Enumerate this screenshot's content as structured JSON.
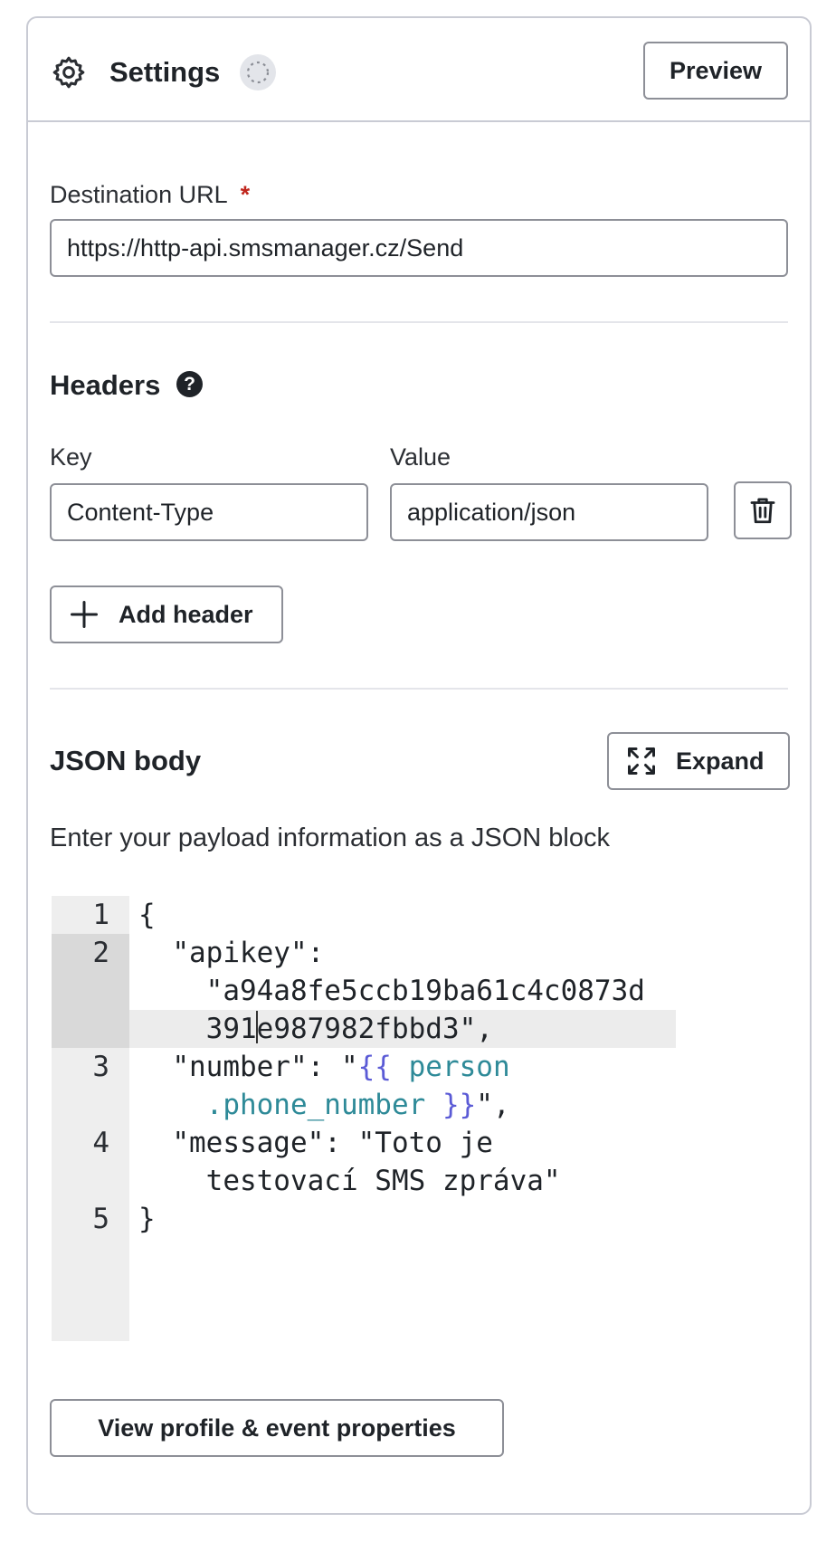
{
  "header": {
    "title": "Settings",
    "preview_label": "Preview"
  },
  "destination": {
    "label": "Destination URL",
    "required_mark": "*",
    "value": "https://http-api.smsmanager.cz/Send"
  },
  "headers": {
    "title": "Headers",
    "help_glyph": "?",
    "key_label": "Key",
    "value_label": "Value",
    "rows": [
      {
        "key": "Content-Type",
        "value": "application/json"
      }
    ],
    "add_label": "Add header"
  },
  "json_body": {
    "title": "JSON body",
    "expand_label": "Expand",
    "description": "Enter your payload information as a JSON block",
    "line_numbers": [
      "1",
      "2",
      "3",
      "4",
      "5"
    ],
    "code": {
      "l1": "{",
      "l2a": "  \"apikey\":",
      "l2b": "    \"a94a8fe5ccb19ba61c4c0873d",
      "l2c_before": "    391",
      "l2c_after": "e987982fbbd3\",",
      "l3_pre": "  \"number\": \"",
      "l3_open": "{{",
      "l3_var1": " person",
      "l3b_indent": "    ",
      "l3_var2": ".phone_number",
      "l3_close": " }}",
      "l3_post": "\",",
      "l4a": "  \"message\": \"Toto je",
      "l4b": "    testovací SMS zpráva\"",
      "l5": "}"
    }
  },
  "footer": {
    "props_label": "View profile & event properties"
  },
  "icons": {
    "settings": "gear-icon",
    "loading": "spinner-icon",
    "help": "question-circle-icon",
    "delete": "trash-icon",
    "add": "plus-icon",
    "expand": "expand-arrows-icon"
  },
  "colors": {
    "required": "#c0261d",
    "template_brace": "#5b5bd6",
    "template_variable": "#2e8a98",
    "border": "#8d8f97"
  }
}
